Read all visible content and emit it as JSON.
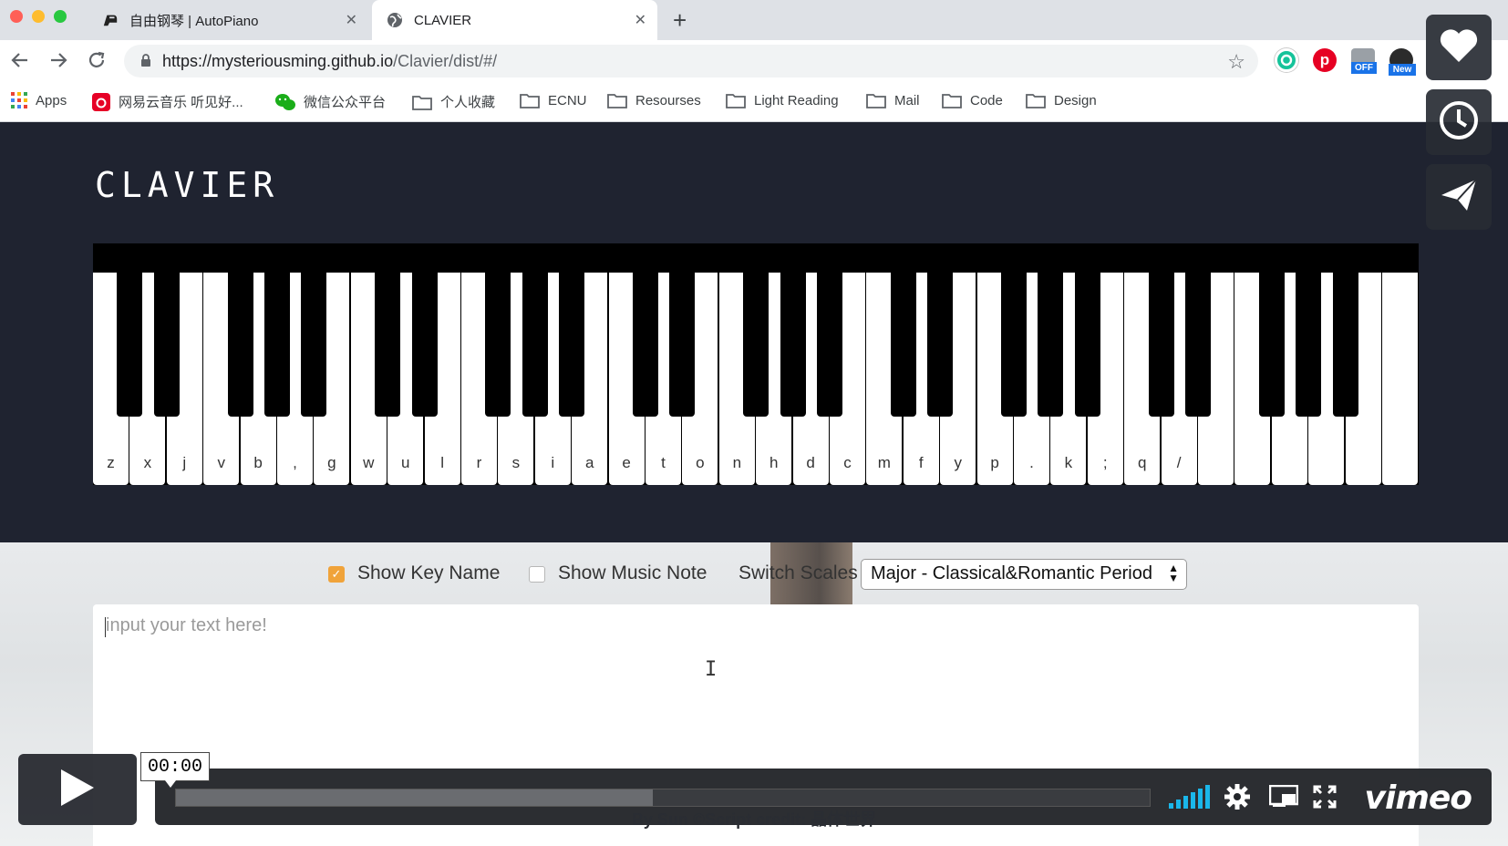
{
  "browser": {
    "tabs": [
      {
        "title": "自由钢琴 | AutoPiano",
        "close": "✕"
      },
      {
        "title": "CLAVIER",
        "close": "✕"
      }
    ],
    "new_tab": "+",
    "url_host": "https://mysteriousming.github.io",
    "url_path": "/Clavier/dist/#/",
    "extensions": [
      {
        "name": "grammarly-icon",
        "color": "#15c39a"
      },
      {
        "name": "pinterest-icon",
        "color": "#e60023"
      },
      {
        "name": "off-extension-icon",
        "badge": "OFF"
      },
      {
        "name": "new-extension-icon",
        "badge": "New"
      }
    ],
    "bookmarks": [
      "Apps",
      "网易云音乐 听见好...",
      "微信公众平台",
      "个人收藏",
      "ECNU",
      "Resourses",
      "Light Reading",
      "Mail",
      "Code",
      "Design"
    ]
  },
  "app": {
    "logo": "CLAVIER",
    "key_labels": [
      "z",
      "x",
      "j",
      "v",
      "b",
      ",",
      "g",
      "w",
      "u",
      "l",
      "r",
      "s",
      "i",
      "a",
      "e",
      "t",
      "o",
      "n",
      "h",
      "d",
      "c",
      "m",
      "f",
      "y",
      "p",
      ".",
      "k",
      ";",
      "q",
      "/",
      "",
      "",
      "",
      "",
      "",
      ""
    ],
    "controls": {
      "show_key_name": "Show Key Name",
      "show_key_name_checked": true,
      "show_music_note": "Show Music Note",
      "show_music_note_checked": false,
      "switch_scales": "Switch Scales",
      "scale_value": "Major - Classical&Romantic Period"
    },
    "textarea_placeholder": "input your text here!"
  },
  "player": {
    "timecode": "00:00",
    "progress_loaded": 0.49,
    "brand": "vimeo",
    "credit": "By Sun ©Script credit: 晶体世界"
  },
  "colors": {
    "page_dark": "#1f2330",
    "checkbox_accent": "#f0a33a"
  }
}
